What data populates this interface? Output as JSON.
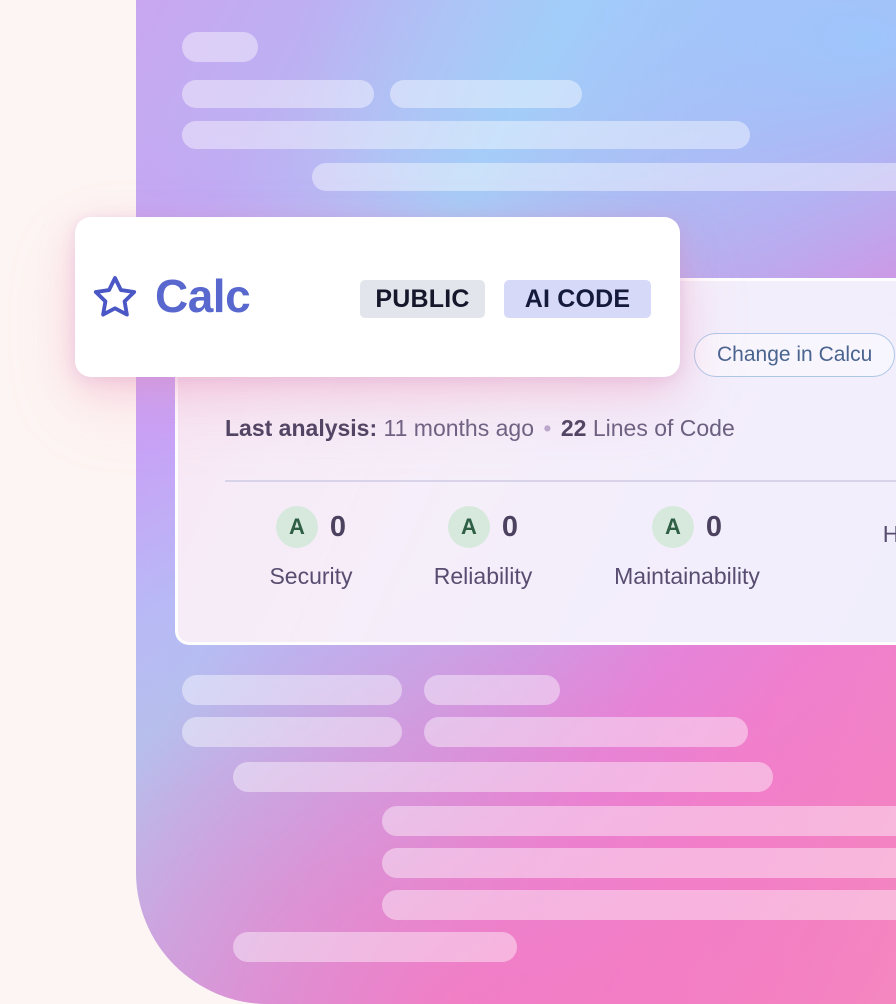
{
  "project": {
    "name": "Calc",
    "favorite_icon": "star-outline-icon",
    "badges": [
      {
        "label": "PUBLIC",
        "bg": "#e3e5ec",
        "fg": "#15182b"
      },
      {
        "label": "AI CODE",
        "bg": "#d6d9f7",
        "fg": "#141a3c"
      }
    ],
    "accent_color": "#5868ce"
  },
  "branch_selector": {
    "label": "Change in Calcu",
    "border_color": "#aec7e8",
    "text_color": "#4a6490"
  },
  "analysis": {
    "label": "Last analysis:",
    "time": "11 months ago",
    "separator": "•",
    "loc_value": "22",
    "loc_label": "Lines of Code"
  },
  "metrics": [
    {
      "grade": "A",
      "value": "0",
      "label": "Security"
    },
    {
      "grade": "A",
      "value": "0",
      "label": "Reliability"
    },
    {
      "grade": "A",
      "value": "0",
      "label": "Maintainability"
    },
    {
      "grade": "",
      "value": "",
      "label": "H"
    }
  ],
  "colors": {
    "page_background": "#fdf5f3",
    "grade_badge_bg": "#d7e9dd",
    "grade_badge_fg": "#2f5f45",
    "panel_text": "#584d70"
  }
}
